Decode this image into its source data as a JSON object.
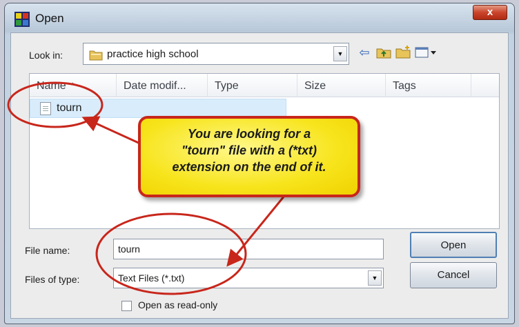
{
  "window": {
    "title": "Open",
    "close_glyph": "x",
    "app_icon": "open-file-app-icon"
  },
  "toolbar": {
    "look_in_label": "Look in:",
    "look_in_value": "practice high school",
    "icons": [
      "back-arrow-icon",
      "up-folder-icon",
      "new-folder-icon",
      "views-menu-icon"
    ]
  },
  "file_list": {
    "columns": [
      "Name",
      "Date modif...",
      "Type",
      "Size",
      "Tags"
    ],
    "files": [
      {
        "name": "tourn",
        "icon": "text-file-icon",
        "selected": true
      }
    ]
  },
  "form": {
    "file_name_label": "File name:",
    "file_name_value": "tourn",
    "files_of_type_label": "Files of type:",
    "files_of_type_value": "Text Files (*.txt)",
    "open_label": "Open",
    "cancel_label": "Cancel",
    "read_only_label": "Open as read-only",
    "read_only_checked": false
  },
  "annotation": {
    "callout_lines": [
      "You are looking for a",
      "\"tourn\" file with a (*txt)",
      "extension on the end of it."
    ],
    "colors": {
      "callout_fill": "#f7e41b",
      "callout_border": "#c8261b",
      "circle": "#c8261b"
    }
  }
}
